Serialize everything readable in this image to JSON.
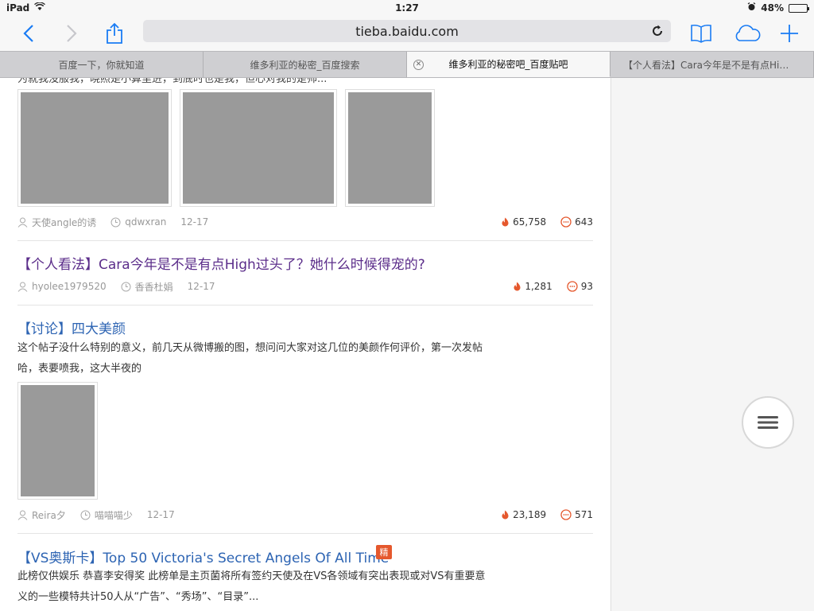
{
  "status_bar": {
    "device": "iPad",
    "time": "1:27",
    "battery": "48%",
    "battery_level": 0.48
  },
  "browser": {
    "url": "tieba.baidu.com",
    "tabs": [
      {
        "label": "百度一下，你就知道",
        "active": false
      },
      {
        "label": "维多利亚的秘密_百度搜索",
        "active": false
      },
      {
        "label": "维多利亚的秘密吧_百度贴吧",
        "active": true
      },
      {
        "label": "【个人看法】Cara今年是不是有点High...",
        "active": false
      }
    ]
  },
  "posts": [
    {
      "partial_text": "为就我没服我，晓照是小算里进，到底时也是我，但心对我的是帅...",
      "images": [
        "photo-1",
        "photo-2",
        "photo-3"
      ],
      "author": "天使angle的诱",
      "last_reply": "qdwxran",
      "date": "12-17",
      "heat": "65,758",
      "replies": "643"
    },
    {
      "title": "【个人看法】Cara今年是不是有点High过头了？她什么时候得宠的?",
      "author": "hyolee1979520",
      "last_reply": "香香杜娟",
      "date": "12-17",
      "heat": "1,281",
      "replies": "93"
    },
    {
      "title": "【讨论】四大美颜",
      "body": "这个帖子没什么特别的意义，前几天从微博搬的图，想问问大家对这几位的美颜作何评价，第一次发帖哈，表要喷我，这大半夜的",
      "images": [
        "photo-4"
      ],
      "author": "Reira夕",
      "last_reply": "喵喵喵少",
      "date": "12-17",
      "heat": "23,189",
      "replies": "571"
    },
    {
      "title": "【VS奥斯卡】Top 50 Victoria's Secret Angels Of All Time",
      "badge": "精",
      "body": "此榜仅供娱乐 恭喜李安得奖 此榜单是主页菌将所有签约天使及在VS各领域有突出表现或对VS有重要意义的一些模特共计50人从“广告”、“秀场”、“目录”..."
    }
  ],
  "colors": {
    "link": "#2d64b3",
    "visited": "#5b2d8a",
    "accent": "#1a7cf4",
    "flame": "#e5582d"
  }
}
